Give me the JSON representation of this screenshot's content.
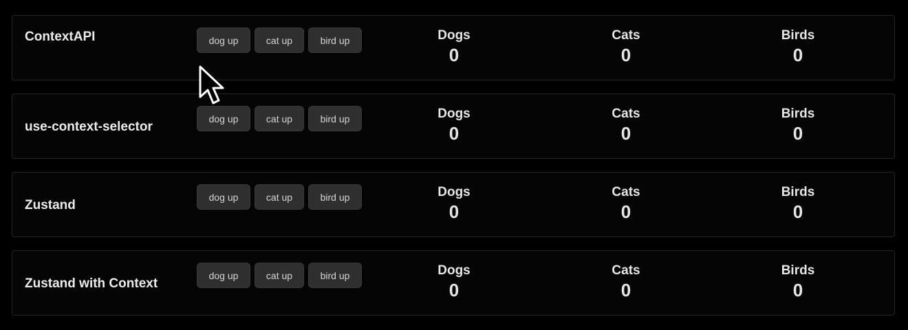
{
  "rows": [
    {
      "title": "ContextAPI",
      "buttons": {
        "dog": "dog up",
        "cat": "cat up",
        "bird": "bird up"
      },
      "counters": {
        "dogs": {
          "label": "Dogs",
          "value": "0"
        },
        "cats": {
          "label": "Cats",
          "value": "0"
        },
        "birds": {
          "label": "Birds",
          "value": "0"
        }
      }
    },
    {
      "title": "use-context-selector",
      "buttons": {
        "dog": "dog up",
        "cat": "cat up",
        "bird": "bird up"
      },
      "counters": {
        "dogs": {
          "label": "Dogs",
          "value": "0"
        },
        "cats": {
          "label": "Cats",
          "value": "0"
        },
        "birds": {
          "label": "Birds",
          "value": "0"
        }
      }
    },
    {
      "title": "Zustand",
      "buttons": {
        "dog": "dog up",
        "cat": "cat up",
        "bird": "bird up"
      },
      "counters": {
        "dogs": {
          "label": "Dogs",
          "value": "0"
        },
        "cats": {
          "label": "Cats",
          "value": "0"
        },
        "birds": {
          "label": "Birds",
          "value": "0"
        }
      }
    },
    {
      "title": "Zustand with Context",
      "buttons": {
        "dog": "dog up",
        "cat": "cat up",
        "bird": "bird up"
      },
      "counters": {
        "dogs": {
          "label": "Dogs",
          "value": "0"
        },
        "cats": {
          "label": "Cats",
          "value": "0"
        },
        "birds": {
          "label": "Birds",
          "value": "0"
        }
      }
    }
  ],
  "cursor": {
    "icon": "mouse-pointer-icon"
  },
  "colors": {
    "background": "#000000",
    "row_border": "#262626",
    "button_bg": "#2f2f2f",
    "text": "#e8e8e8"
  }
}
